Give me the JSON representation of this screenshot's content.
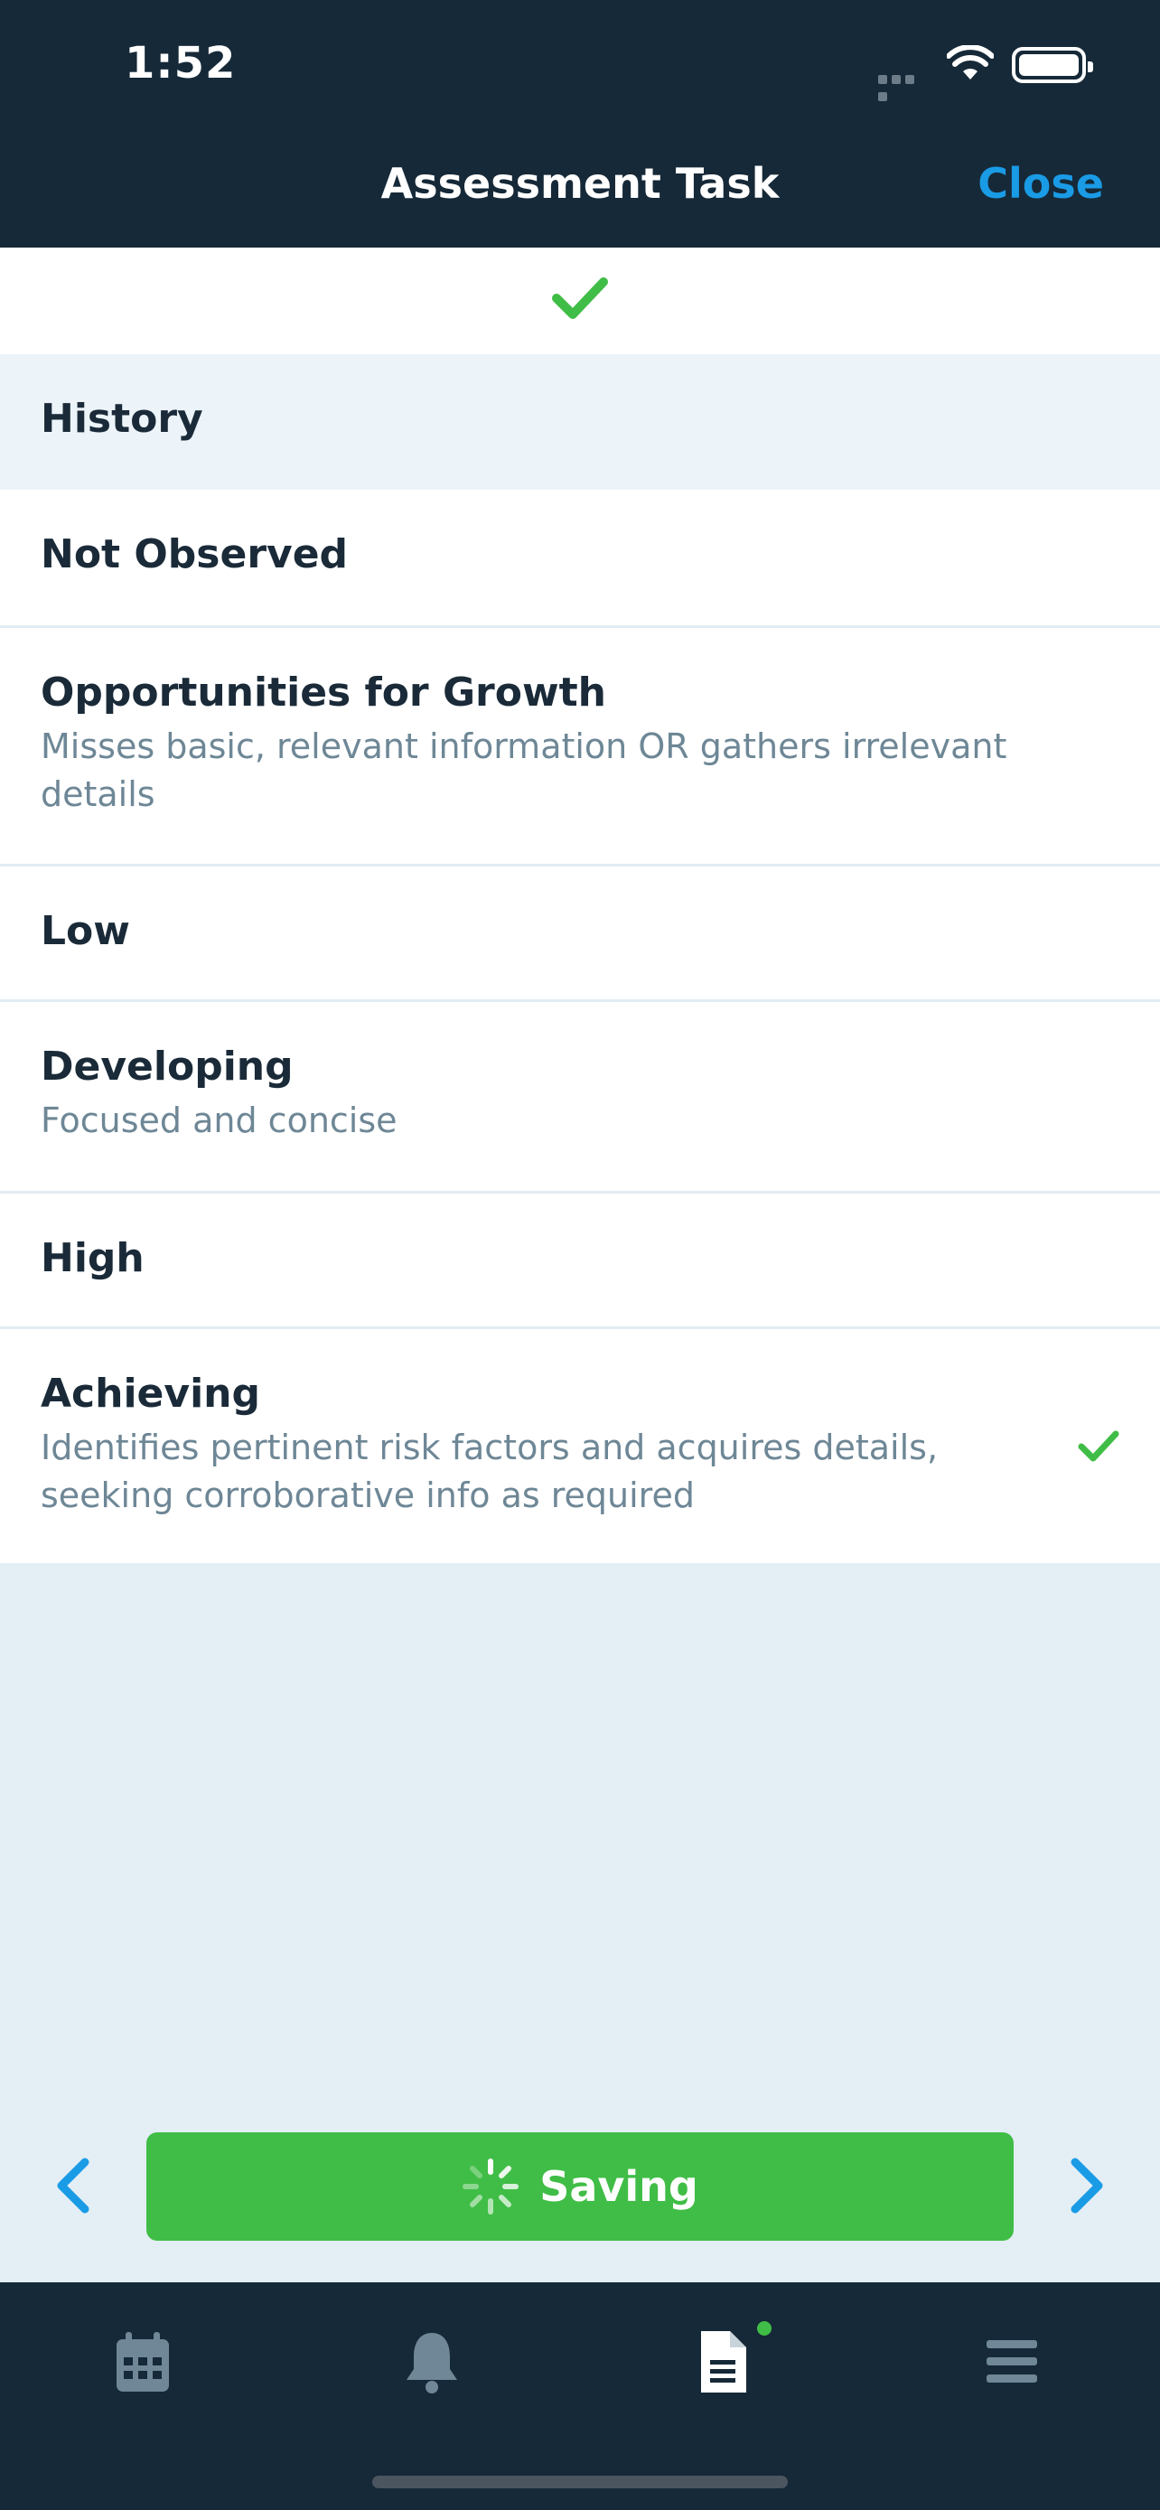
{
  "status_bar": {
    "time": "1:52"
  },
  "nav": {
    "title": "Assessment Task",
    "close_label": "Close"
  },
  "section": {
    "title": "History"
  },
  "options": [
    {
      "title": "Not Observed",
      "description": "",
      "selected": false
    },
    {
      "title": "Opportunities for Growth",
      "description": "Misses basic, relevant information OR gathers irrelevant details",
      "selected": false
    },
    {
      "title": "Low",
      "description": "",
      "selected": false
    },
    {
      "title": "Developing",
      "description": "Focused and concise",
      "selected": false
    },
    {
      "title": "High",
      "description": "",
      "selected": false
    },
    {
      "title": "Achieving",
      "description": "Identifies pertinent risk factors and acquires details, seeking corroborative info as required",
      "selected": true
    }
  ],
  "actions": {
    "saving_label": "Saving"
  },
  "tabs": [
    {
      "icon": "calendar-icon"
    },
    {
      "icon": "bell-icon"
    },
    {
      "icon": "document-icon",
      "active": true,
      "badge": true
    },
    {
      "icon": "menu-icon"
    }
  ],
  "colors": {
    "header_bg": "#162938",
    "accent_blue": "#1a9be6",
    "success_green": "#40bd46",
    "page_bg": "#e3eef5"
  }
}
